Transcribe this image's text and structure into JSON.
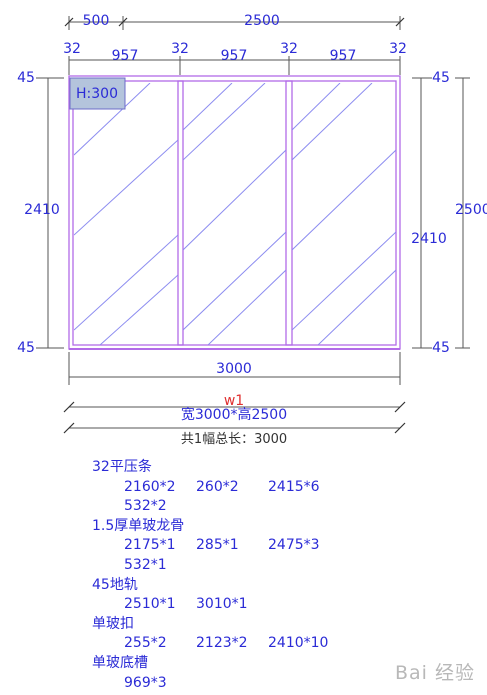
{
  "dimensions": {
    "top_left": "500",
    "top_total": "2500",
    "top_segments": [
      "32",
      "957",
      "32",
      "957",
      "32",
      "957",
      "32"
    ],
    "left_top": "45",
    "left_middle": "2410",
    "left_bottom": "45",
    "right_top": "45",
    "right_middle": "2410",
    "right_bottom": "45",
    "right_total": "2500",
    "bottom_width": "3000"
  },
  "window": {
    "id": "w1",
    "size_label": "宽3000*高2500",
    "total_label": "共1幅总长：3000",
    "handle_label": "H:300"
  },
  "bom": [
    {
      "title": "32平压条",
      "rows": [
        [
          "2160*2",
          "260*2",
          "2415*6"
        ],
        [
          "532*2"
        ]
      ]
    },
    {
      "title": "1.5厚单玻龙骨",
      "rows": [
        [
          "2175*1",
          "285*1",
          "2475*3"
        ],
        [
          "532*1"
        ]
      ]
    },
    {
      "title": "45地轨",
      "rows": [
        [
          "2510*1",
          "3010*1"
        ]
      ]
    },
    {
      "title": "单玻扣",
      "rows": [
        [
          "255*2",
          "2123*2",
          "2410*10"
        ]
      ]
    },
    {
      "title": "单玻底槽",
      "rows": [
        [
          "969*3"
        ]
      ]
    }
  ],
  "watermark": "Bai 经验"
}
